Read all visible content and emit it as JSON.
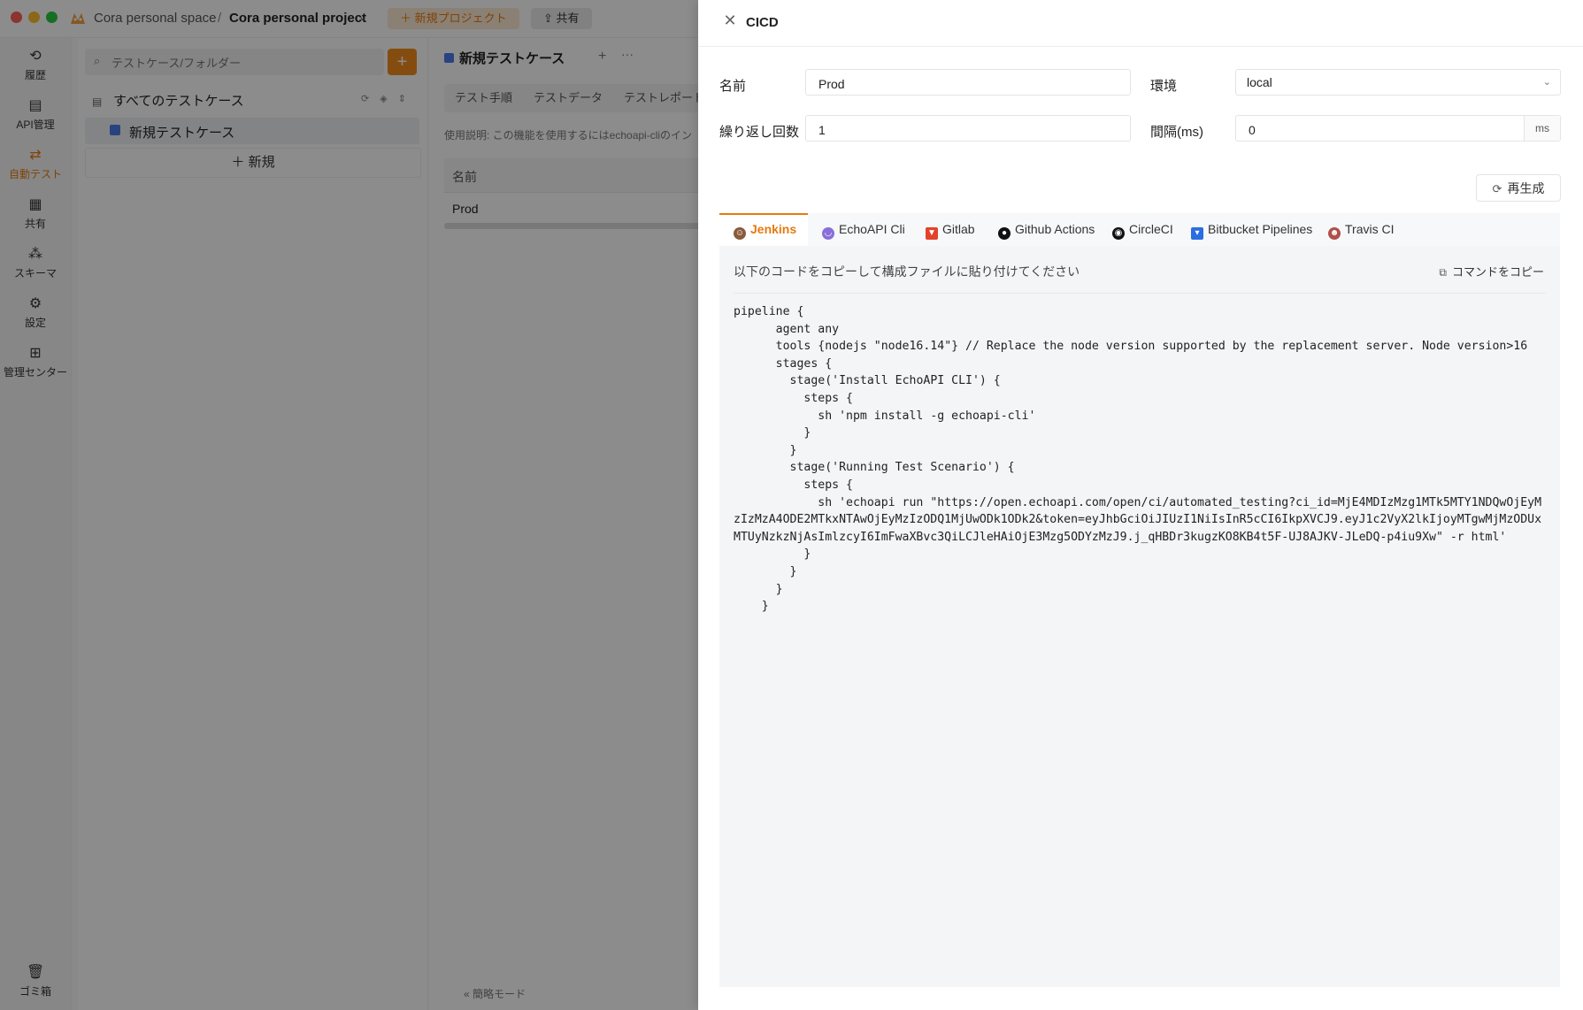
{
  "titlebar": {
    "space": "Cora personal space",
    "separator": "/",
    "project": "Cora personal project",
    "new_project_button": "＋ 新規プロジェクト",
    "share_button": "共有"
  },
  "nav": {
    "history": "履歴",
    "api": "API管理",
    "autotest": "自動テスト",
    "share": "共有",
    "schema": "スキーマ",
    "settings": "設定",
    "admin": "管理センター",
    "trash": "ゴミ箱"
  },
  "tree": {
    "search_placeholder": "テストケース/フォルダー",
    "root_label": "すべてのテストケース",
    "item_label": "新規テストケース",
    "new_label": "＋  新規"
  },
  "center": {
    "tab_label": "新規テストケース",
    "subtabs": [
      "テスト手順",
      "テストデータ",
      "テストレポート"
    ],
    "usage_text": "使用説明: この機能を使用するにはechoapi-cliのイン",
    "table_header": "名前",
    "table_row": "Prod",
    "simple_mode": "«   簡略モード"
  },
  "drawer": {
    "title": "CICD",
    "name_label": "名前",
    "name_value": "Prod",
    "env_label": "環境",
    "env_value": "local",
    "repeat_label": "繰り返し回数",
    "repeat_value": "1",
    "interval_label": "間隔(ms)",
    "interval_value": "0",
    "interval_unit": "ms",
    "regenerate": "再生成",
    "tabs": [
      "Jenkins",
      "EchoAPI Cli",
      "Gitlab",
      "Github Actions",
      "CircleCI",
      "Bitbucket Pipelines",
      "Travis CI"
    ],
    "active_tab": "Jenkins",
    "hint": "以下のコードをコピーして構成ファイルに貼り付けてください",
    "copy_command": "コマンドをコピー",
    "code": "pipeline {\n      agent any\n      tools {nodejs \"node16.14\"} // Replace the node version supported by the replacement server. Node version>16\n      stages {\n        stage('Install EchoAPI CLI') {\n          steps {\n            sh 'npm install -g echoapi-cli'\n          }\n        }\n        stage('Running Test Scenario') {\n          steps {\n            sh 'echoapi run \"https://open.echoapi.com/open/ci/automated_testing?ci_id=MjE4MDIzMzg1MTk5MTY1NDQwOjEyMzIzMzA4ODE2MTkxNTAwOjEyMzIzODQ1MjUwODk1ODk2&token=eyJhbGciOiJIUzI1NiIsInR5cCI6IkpXVCJ9.eyJ1c2VyX2lkIjoyMTgwMjMzODUxMTUyNzkzNjAsImlzcyI6ImFwaXBvc3QiLCJleHAiOjE3Mzg5ODYzMzJ9.j_qHBDr3kugzKO8KB4t5F-UJ8AJKV-JLeDQ-p4iu9Xw\" -r html'\n          }\n        }\n      }\n    }"
  },
  "colors": {
    "accent": "#e57a10",
    "overlay": "rgba(0,0,0,0.45)"
  }
}
